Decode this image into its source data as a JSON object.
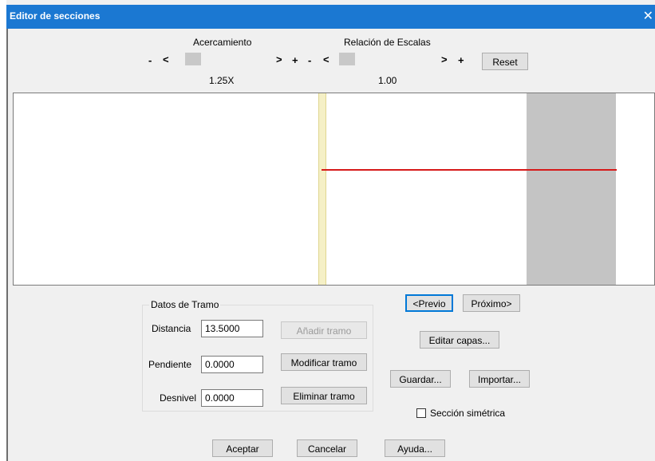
{
  "window": {
    "title": "Editor de secciones",
    "close_glyph": "✕"
  },
  "zoom": {
    "label": "Acercamiento",
    "minus": "-",
    "left": "<",
    "right": ">",
    "plus": "+",
    "value": "1.25X"
  },
  "scale": {
    "label": "Relación de Escalas",
    "minus": "-",
    "left": "<",
    "right": ">",
    "plus": "+",
    "value": "1.00",
    "reset_label": "Reset"
  },
  "nav": {
    "prev_label": "<Previo",
    "next_label": "Próximo>"
  },
  "segment": {
    "group_title": "Datos de Tramo",
    "distance_label": "Distancia",
    "distance_value": "13.5000",
    "slope_label": "Pendiente",
    "slope_value": "0.0000",
    "drop_label": "Desnivel",
    "drop_value": "0.0000",
    "add_label": "Añadir tramo",
    "modify_label": "Modificar tramo",
    "delete_label": "Eliminar tramo"
  },
  "actions": {
    "edit_layers_label": "Editar capas...",
    "save_label": "Guardar...",
    "import_label": "Importar...",
    "symmetric_label": "Sección simétrica",
    "symmetric_checked": false
  },
  "footer": {
    "ok_label": "Aceptar",
    "cancel_label": "Cancelar",
    "help_label": "Ayuda..."
  },
  "colors": {
    "titlebar": "#1b78d2",
    "profile_line": "#d61a1a",
    "axis_band": "#f5f0c6",
    "side_area": "#c4c4c4"
  }
}
